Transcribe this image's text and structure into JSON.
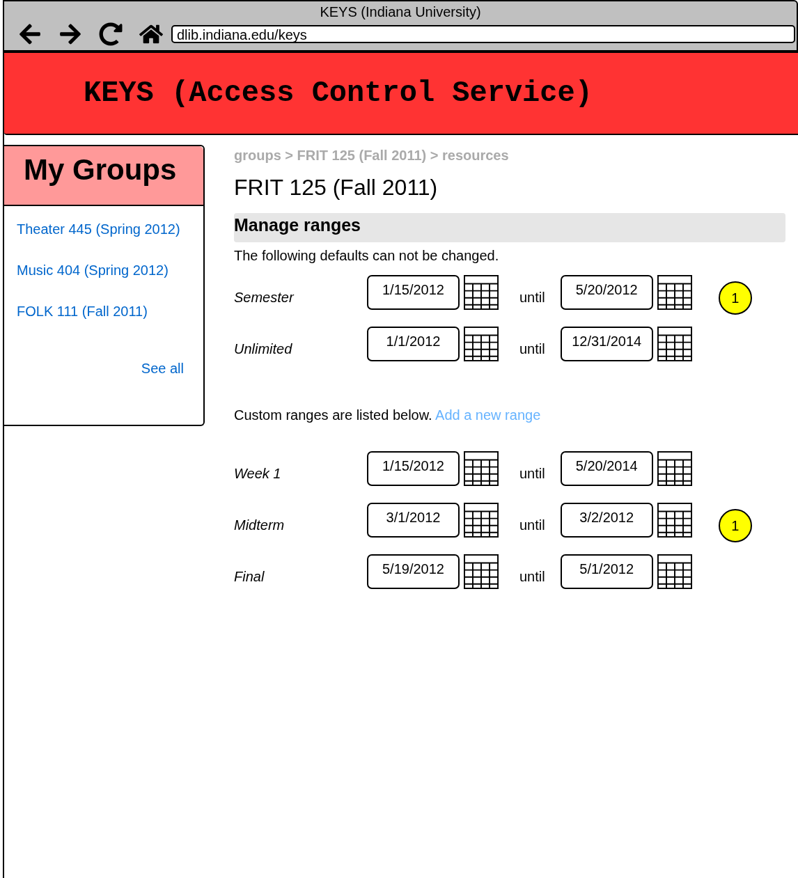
{
  "browser": {
    "title": "KEYS (Indiana University)",
    "url": "dlib.indiana.edu/keys"
  },
  "header": {
    "title": "KEYS (Access Control Service)"
  },
  "sidebar": {
    "title": "My Groups",
    "items": [
      {
        "label": "Theater 445 (Spring 2012)"
      },
      {
        "label": "Music 404 (Spring 2012)"
      },
      {
        "label": "FOLK 111 (Fall 2011)"
      }
    ],
    "see_all": "See all"
  },
  "breadcrumb": "groups > FRIT 125 (Fall 2011) > resources",
  "page_title": "FRIT 125 (Fall 2011)",
  "section_title": "Manage ranges",
  "defaults_note": "The following defaults can not be changed.",
  "default_ranges": [
    {
      "label": "Semester",
      "start": "1/15/2012",
      "until": "until",
      "end": "5/20/2012",
      "badge": "1"
    },
    {
      "label": "Unlimited",
      "start": "1/1/2012",
      "until": "until",
      "end": "12/31/2014"
    }
  ],
  "custom_note": {
    "text": "Custom ranges are listed below.",
    "link": "Add a new range"
  },
  "custom_ranges": [
    {
      "label": "Week 1",
      "start": "1/15/2012",
      "until": "until",
      "end": "5/20/2014"
    },
    {
      "label": "Midterm",
      "start": "3/1/2012",
      "until": "until",
      "end": "3/2/2012",
      "badge": "1"
    },
    {
      "label": "Final",
      "start": "5/19/2012",
      "until": "until",
      "end": "5/1/2012"
    }
  ]
}
